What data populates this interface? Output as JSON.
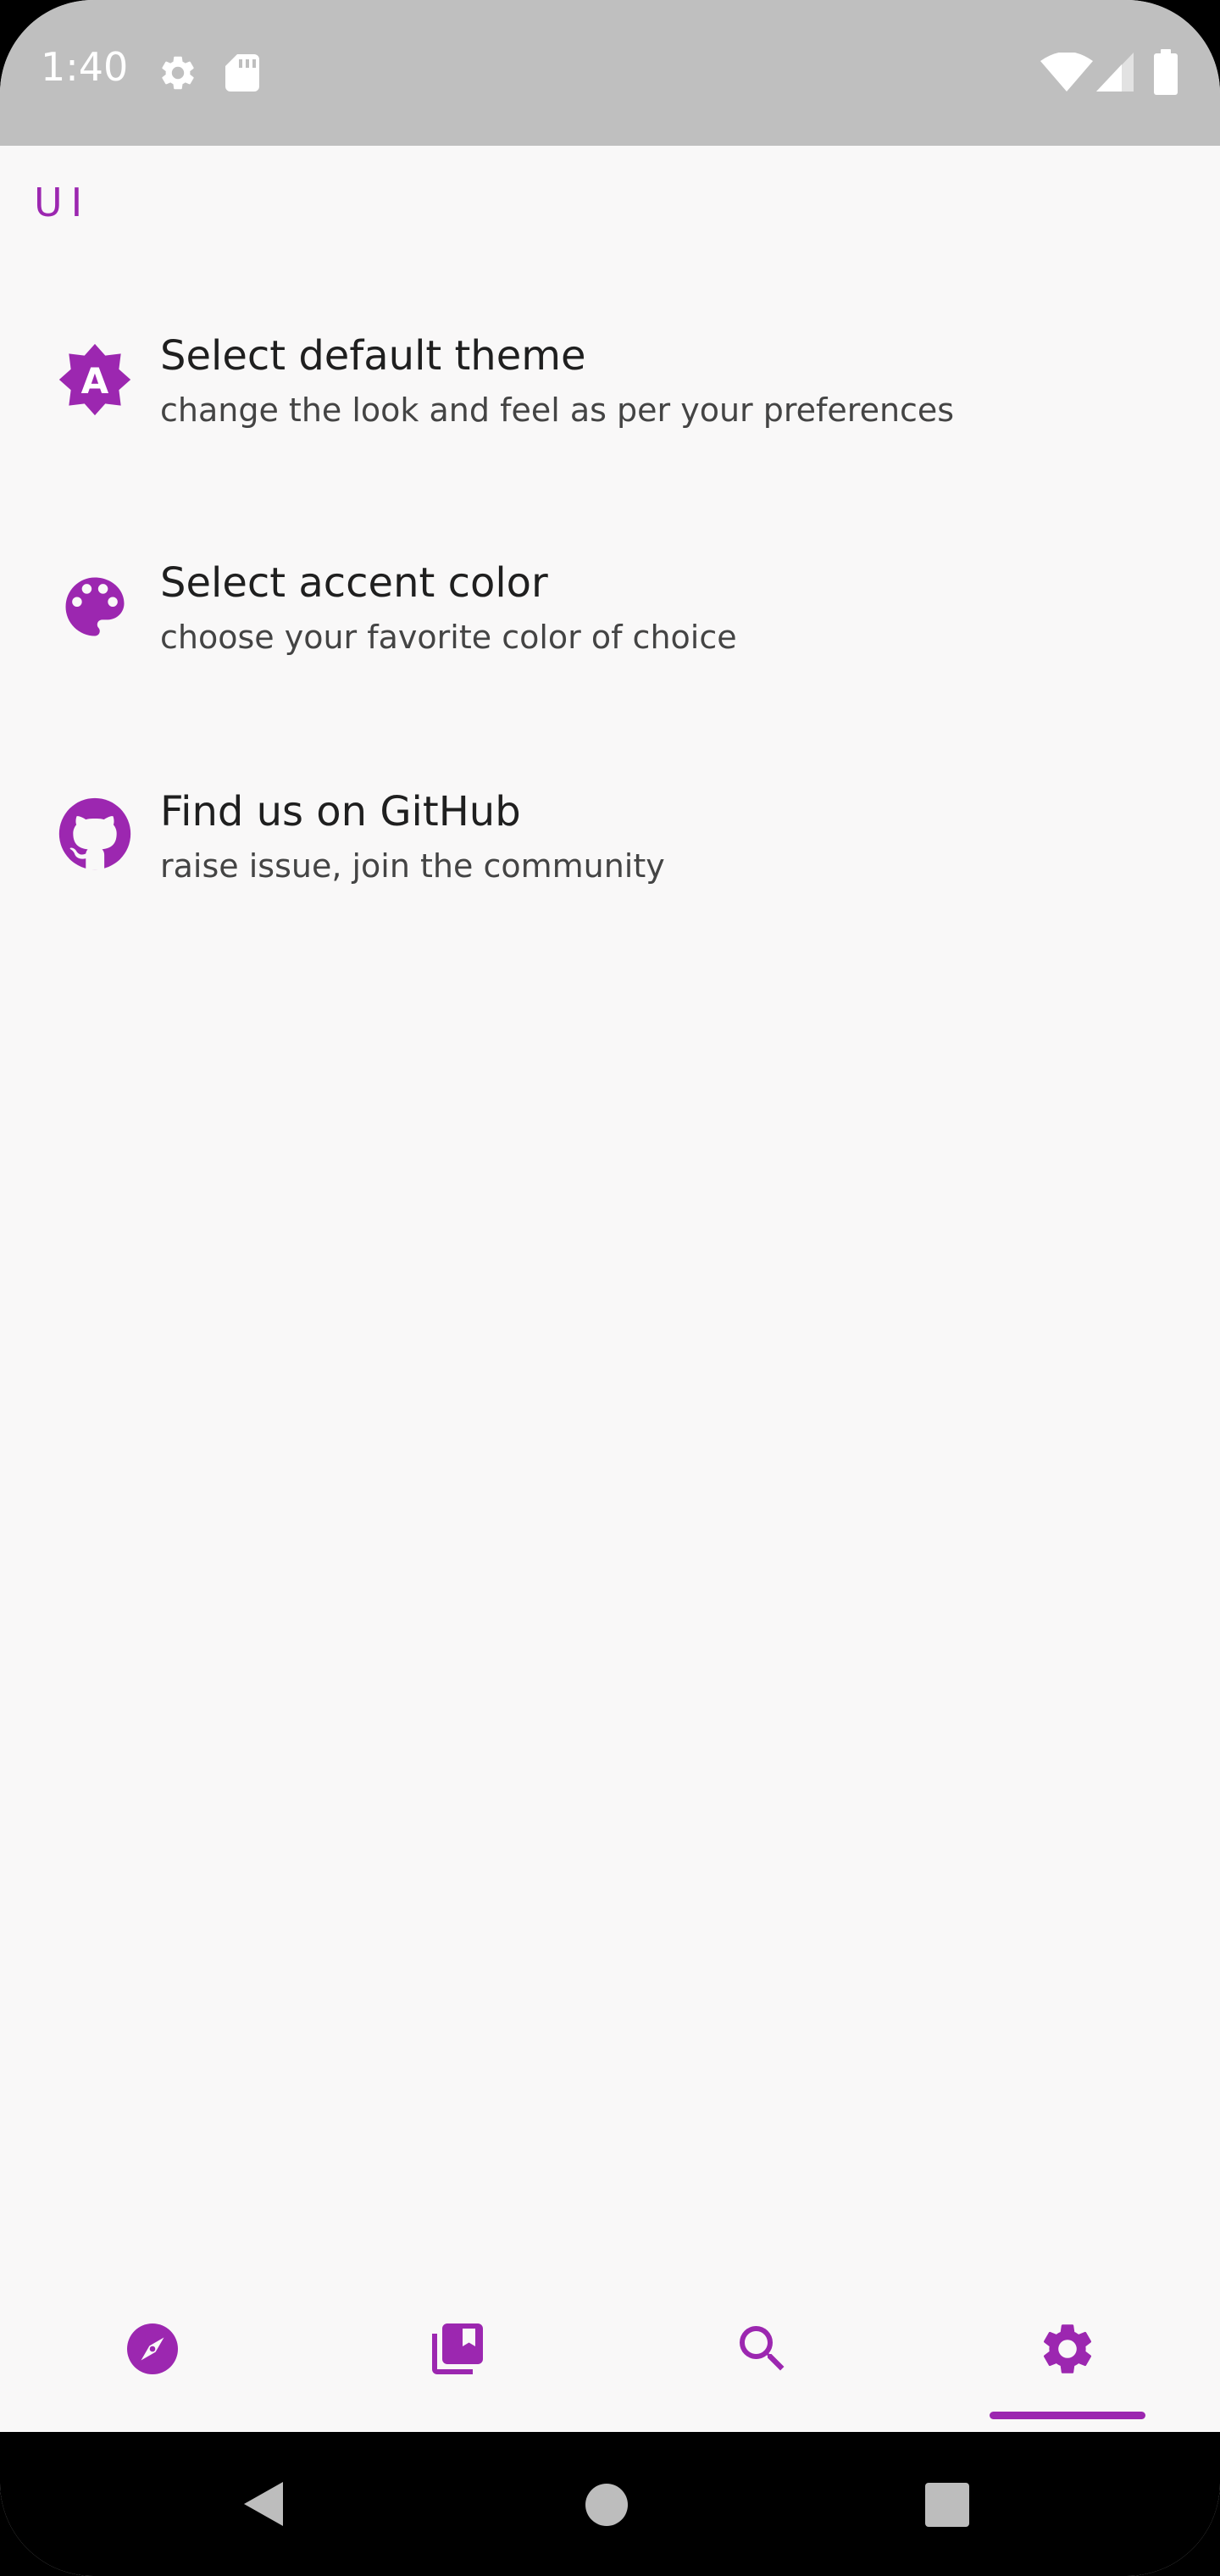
{
  "status_bar": {
    "time": "1:40",
    "icons": [
      "gear-icon",
      "sd-card-icon",
      "wifi-icon",
      "signal-icon",
      "battery-icon"
    ]
  },
  "section": {
    "header": "UI"
  },
  "settings_items": [
    {
      "icon": "theme-badge-icon",
      "title": "Select default theme",
      "subtitle": "change the look and feel as per your preferences"
    },
    {
      "icon": "palette-icon",
      "title": "Select accent color",
      "subtitle": "choose your favorite color of choice"
    },
    {
      "icon": "github-icon",
      "title": "Find us on GitHub",
      "subtitle": "raise issue, join the community"
    }
  ],
  "bottom_nav": {
    "items": [
      "explore-icon",
      "library-icon",
      "search-icon",
      "settings-icon"
    ],
    "selected": "settings-icon"
  },
  "system_nav": {
    "buttons": [
      "back-icon",
      "home-icon",
      "recents-icon"
    ]
  },
  "colors": {
    "accent": "#9c27b0",
    "background": "#f9f8f8",
    "status_bar": "#bfbfbf",
    "system_nav": "#000000"
  }
}
